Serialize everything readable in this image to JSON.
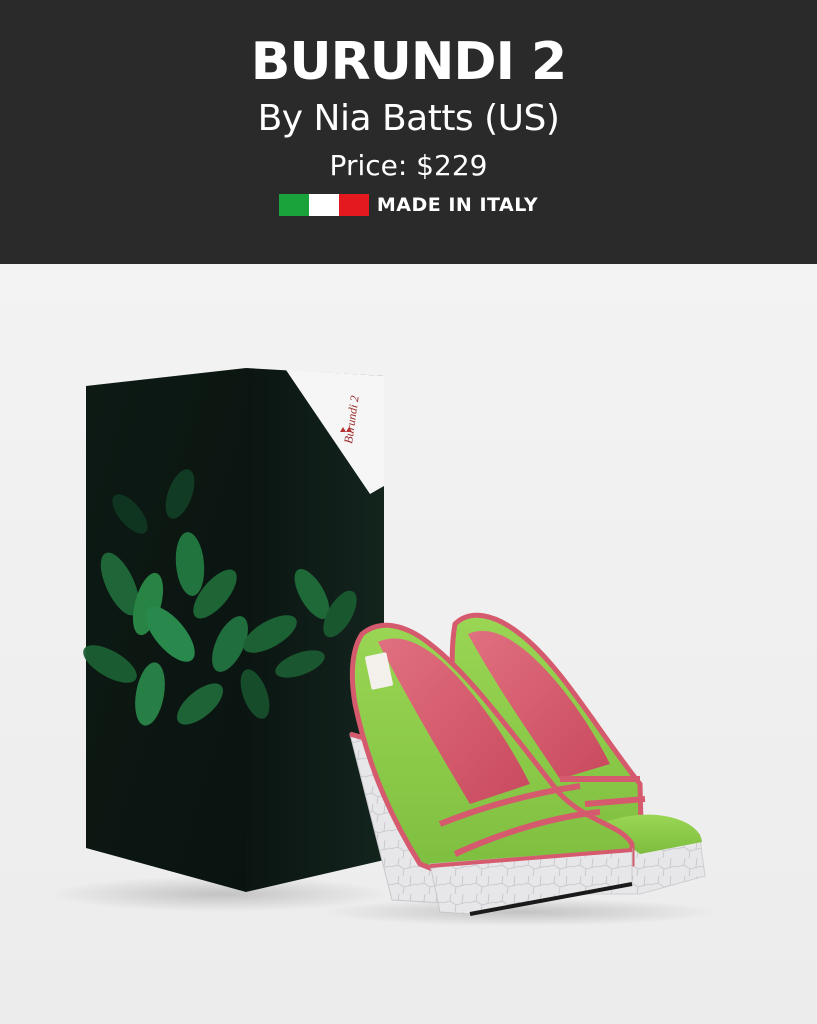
{
  "product": {
    "title": "BURUNDI 2",
    "byline": "By Nia Batts (US)",
    "price": "Price: $229",
    "origin_label": "MADE IN ITALY"
  },
  "flag": {
    "colors": [
      "#1aa33b",
      "#ffffff",
      "#e3191f"
    ]
  },
  "box": {
    "brand_name": "Burundi 2"
  },
  "colors": {
    "header_bg": "#2a2a2a",
    "shoe_green": "#8fcf4a",
    "shoe_pink": "#d65a6e",
    "sole_white": "#e6e6e8"
  }
}
